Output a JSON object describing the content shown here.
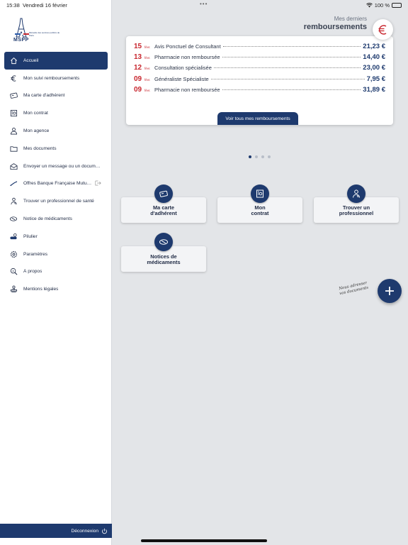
{
  "status": {
    "time": "15:38",
    "date": "Vendredi 16 février",
    "battery": "100 %"
  },
  "logo": {
    "name": "MSPP",
    "subtitle": "Mutuelle des services publics de Paris"
  },
  "sidebar": {
    "items": [
      {
        "label": "Accueil",
        "icon": "home-icon",
        "active": true
      },
      {
        "label": "Mon suivi remboursements",
        "icon": "euro-icon"
      },
      {
        "label": "Ma carte d'adhérent",
        "icon": "card-icon"
      },
      {
        "label": "Mon contrat",
        "icon": "contract-icon"
      },
      {
        "label": "Mon agence",
        "icon": "agent-icon"
      },
      {
        "label": "Mes documents",
        "icon": "folder-icon"
      },
      {
        "label": "Envoyer un message ou un docum…",
        "icon": "mail-icon"
      },
      {
        "label": "Offres Banque Française Mutu…",
        "icon": "bank-icon",
        "external": true
      },
      {
        "label": "Trouver un professionnel de santé",
        "icon": "doctor-icon"
      },
      {
        "label": "Notice de médicaments",
        "icon": "pill-icon"
      },
      {
        "label": "Pilulier",
        "icon": "pillbox-icon"
      },
      {
        "label": "Paramètres",
        "icon": "gear-icon"
      },
      {
        "label": "À propos",
        "icon": "info-search-icon"
      },
      {
        "label": "Mentions légales",
        "icon": "stamp-icon"
      }
    ],
    "logout": "Déconnexion"
  },
  "reimbursements": {
    "heading_small": "Mes derniers",
    "heading_big": "remboursements",
    "rows": [
      {
        "day": "15",
        "month": "févr.",
        "label": "Avis Ponctuel de Consultant",
        "amount": "21,23 €"
      },
      {
        "day": "13",
        "month": "févr.",
        "label": "Pharmacie non remboursée",
        "amount": "14,40 €"
      },
      {
        "day": "12",
        "month": "févr.",
        "label": "Consultation spécialisée",
        "amount": "23,00 €"
      },
      {
        "day": "09",
        "month": "févr.",
        "label": "Généraliste Spécialiste",
        "amount": "7,95 €"
      },
      {
        "day": "09",
        "month": "févr.",
        "label": "Pharmacie non remboursée",
        "amount": "31,89 €"
      }
    ],
    "see_all": "Voir tous mes remboursements"
  },
  "tiles": [
    {
      "label": "Ma carte\nd'adhérent",
      "icon": "card-icon"
    },
    {
      "label": "Mon\ncontrat",
      "icon": "contract-icon"
    },
    {
      "label": "Trouver un\nprofessionnel",
      "icon": "doctor-icon"
    },
    {
      "label": "Notices de\nmédicaments",
      "icon": "pill-icon"
    }
  ],
  "fab": {
    "hint": "Nous adresser vos documents",
    "icon": "plus-icon"
  },
  "colors": {
    "primary": "#1e3a6e",
    "accent": "#c8272f",
    "background": "#e3e5e8"
  }
}
